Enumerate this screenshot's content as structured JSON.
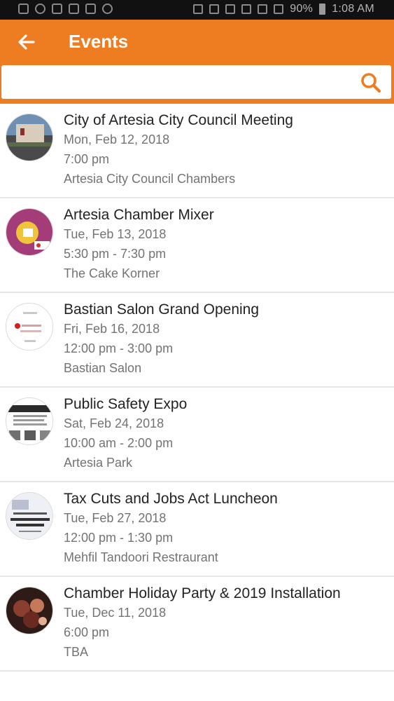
{
  "status_bar": {
    "battery_text": "90%",
    "time": "1:08 AM"
  },
  "app_bar": {
    "title": "Events",
    "back_icon": "arrow-left-icon"
  },
  "search": {
    "value": "",
    "placeholder": "",
    "icon": "search-icon"
  },
  "colors": {
    "accent": "#ee7d22",
    "title_text": "#222222",
    "meta_text": "#737373",
    "divider": "#e6e6e6"
  },
  "events": [
    {
      "title": "City of Artesia City Council Meeting",
      "date": "Mon, Feb 12, 2018",
      "time": "7:00 pm",
      "location": "Artesia City Council Chambers"
    },
    {
      "title": "Artesia Chamber Mixer",
      "date": "Tue, Feb 13, 2018",
      "time": "5:30 pm - 7:30 pm",
      "location": "The Cake Korner"
    },
    {
      "title": "Bastian Salon Grand Opening",
      "date": "Fri, Feb 16, 2018",
      "time": "12:00 pm - 3:00 pm",
      "location": "Bastian Salon"
    },
    {
      "title": "Public Safety Expo",
      "date": "Sat, Feb 24, 2018",
      "time": "10:00 am - 2:00 pm",
      "location": "Artesia Park"
    },
    {
      "title": "Tax Cuts and Jobs Act Luncheon",
      "date": "Tue, Feb 27, 2018",
      "time": "12:00 pm - 1:30 pm",
      "location": "Mehfil Tandoori Restraurant"
    },
    {
      "title": "Chamber Holiday Party & 2019 Installation",
      "date": "Tue, Dec 11, 2018",
      "time": "6:00 pm",
      "location": "TBA"
    }
  ]
}
